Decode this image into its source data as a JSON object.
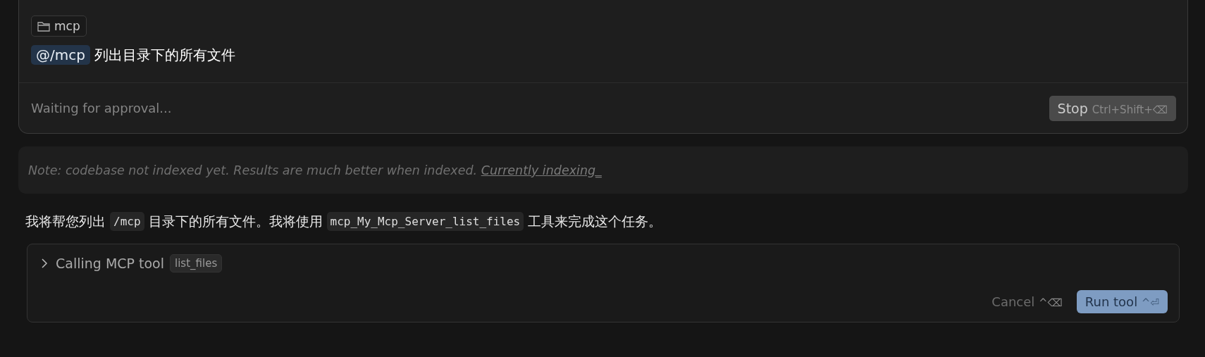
{
  "composer": {
    "context_chip": "mcp",
    "mention": "@/mcp",
    "prompt": "列出目录下的所有文件",
    "status": "Waiting for approval...",
    "stop_button": {
      "label": "Stop",
      "shortcut": "Ctrl+Shift+⌫"
    }
  },
  "note": {
    "text": "Note: codebase not indexed yet. Results are much better when indexed.",
    "link": "Currently indexing_"
  },
  "message": [
    {
      "kind": "text",
      "text": "我将帮您列出"
    },
    {
      "kind": "code",
      "text": "/mcp"
    },
    {
      "kind": "text",
      "text": "目录下的所有文件。我将使用"
    },
    {
      "kind": "code",
      "text": "mcp_My_Mcp_Server_list_files"
    },
    {
      "kind": "text",
      "text": "工具来完成这个任务。"
    }
  ],
  "tool_call": {
    "expanded": false,
    "label": "Calling MCP tool",
    "tool": "list_files",
    "cancel": {
      "label": "Cancel",
      "shortcut": "^⌫"
    },
    "run": {
      "label": "Run tool",
      "shortcut": "^⏎"
    }
  }
}
